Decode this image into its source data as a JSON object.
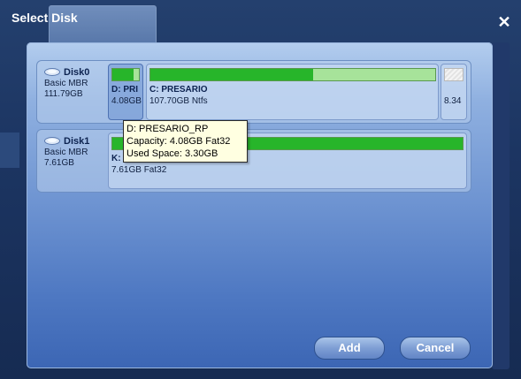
{
  "window": {
    "title": "Select Disk",
    "close_glyph": "✕",
    "icons": {
      "close": "close-icon",
      "disk": "hard-disk-icon"
    }
  },
  "disks": [
    {
      "name": "Disk0",
      "type": "Basic MBR",
      "capacity": "111.79GB",
      "partitions": [
        {
          "label": "D: PRI",
          "size": "4.08GB",
          "used_fraction": 0.81,
          "selected": true
        },
        {
          "label": "C: PRESARIO",
          "size": "107.70GB Ntfs",
          "used_fraction": 0.57,
          "selected": false
        },
        {
          "label": "",
          "size": "8.34",
          "used_fraction": 0,
          "unallocated": true,
          "selected": false
        }
      ]
    },
    {
      "name": "Disk1",
      "type": "Basic MBR",
      "capacity": "7.61GB",
      "partitions": [
        {
          "label": "K:",
          "size": "7.61GB Fat32",
          "used_fraction": 1.0,
          "selected": false
        }
      ]
    }
  ],
  "tooltip": {
    "line1": "D: PRESARIO_RP",
    "line2": "Capacity: 4.08GB Fat32",
    "line3": "Used Space: 3.30GB"
  },
  "buttons": {
    "add_label": "Add",
    "cancel_label": "Cancel"
  },
  "colors": {
    "used": "#27b52a",
    "free": "#a7e39a",
    "tooltip_bg": "#ffffe1",
    "panel_accent": "#4e78c2"
  }
}
